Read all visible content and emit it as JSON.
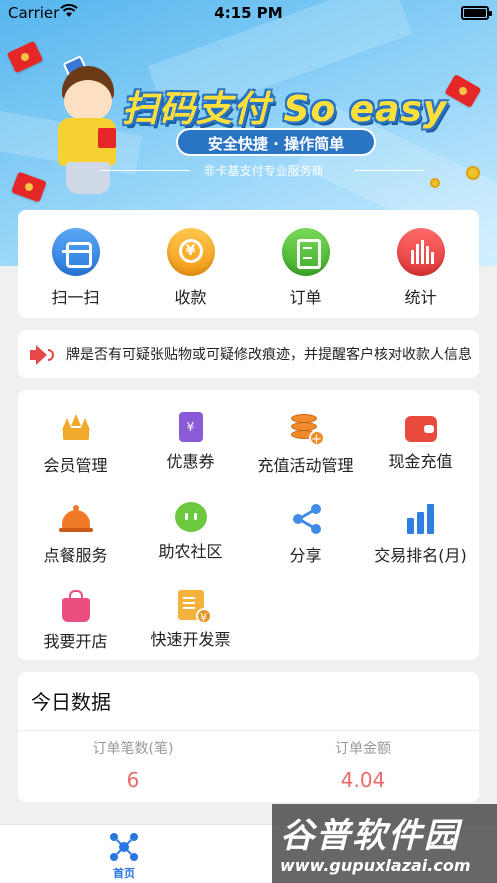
{
  "status_bar": {
    "carrier": "Carrier",
    "time": "4:15 PM"
  },
  "banner": {
    "headline": "扫码支付 So easy",
    "slogan": "安全快捷 · 操作简单",
    "subtitle": "非卡基支付专业服务商"
  },
  "quick_actions": [
    {
      "label": "扫一扫",
      "icon": "scan-icon"
    },
    {
      "label": "收款",
      "icon": "yuan-coin-icon"
    },
    {
      "label": "订单",
      "icon": "clipboard-icon"
    },
    {
      "label": "统计",
      "icon": "bar-chart-icon"
    }
  ],
  "notice": {
    "text": "牌是否有可疑张贴物或可疑修改痕迹，并提醒客户核对收款人信息"
  },
  "menu": [
    {
      "label": "会员管理",
      "icon": "crown-icon"
    },
    {
      "label": "优惠券",
      "icon": "coupon-icon"
    },
    {
      "label": "充值活动管理",
      "icon": "coins-plus-icon"
    },
    {
      "label": "现金充值",
      "icon": "wallet-icon"
    },
    {
      "label": "点餐服务",
      "icon": "food-cover-icon"
    },
    {
      "label": "助农社区",
      "icon": "chat-bubble-icon"
    },
    {
      "label": "分享",
      "icon": "share-icon"
    },
    {
      "label": "交易排名(月)",
      "icon": "ranking-bars-icon"
    },
    {
      "label": "我要开店",
      "icon": "shopping-bag-icon"
    },
    {
      "label": "快速开发票",
      "icon": "invoice-icon"
    }
  ],
  "today": {
    "title": "今日数据",
    "stats": [
      {
        "label": "订单笔数(笔)",
        "value": "6"
      },
      {
        "label": "订单金额",
        "value": "4.04"
      }
    ]
  },
  "tabbar": {
    "home_label": "首页"
  },
  "watermark": {
    "line1": "谷普软件园",
    "line2": "www.gupuxlazai.com"
  },
  "colors": {
    "primary_blue": "#2a76e0",
    "value_red": "#ec6a6a",
    "banner_yellow": "#ffe03a"
  }
}
